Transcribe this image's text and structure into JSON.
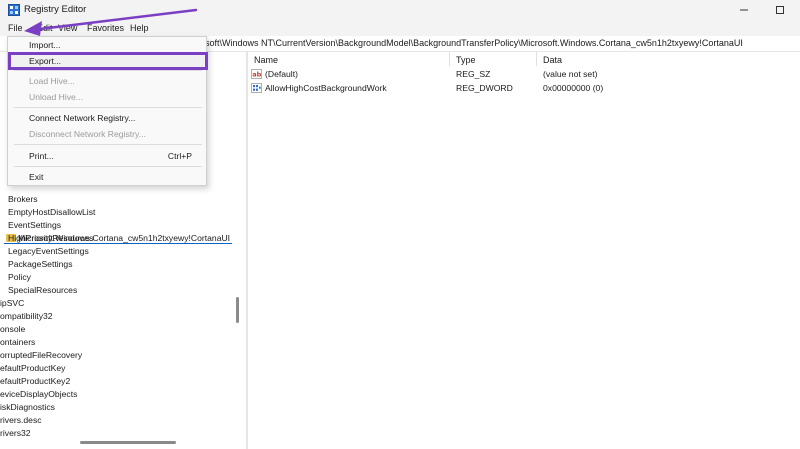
{
  "window": {
    "title": "Registry Editor"
  },
  "menubar": {
    "file": "File",
    "edit": "Edit",
    "view": "View",
    "favorites": "Favorites",
    "help": "Help"
  },
  "address": {
    "path": "osoft\\Windows NT\\CurrentVersion\\BackgroundModel\\BackgroundTransferPolicy\\Microsoft.Windows.Cortana_cw5n1h2txyewy!CortanaUI"
  },
  "file_menu": {
    "import": "Import...",
    "export": "Export...",
    "load_hive": "Load Hive...",
    "unload_hive": "Unload Hive...",
    "connect": "Connect Network Registry...",
    "disconnect": "Disconnect Network Registry...",
    "print": "Print...",
    "print_shortcut": "Ctrl+P",
    "exit": "Exit"
  },
  "tree": {
    "selected": "Microsoft.Windows.Cortana_cw5n1h2txyewy!CortanaUI",
    "children": [
      "Brokers",
      "EmptyHostDisallowList",
      "EventSettings",
      "HighPriorityResources",
      "LegacyEventSettings",
      "PackageSettings",
      "Policy",
      "SpecialResources"
    ],
    "siblings": [
      "ipSVC",
      "ompatibility32",
      "onsole",
      "ontainers",
      "orruptedFileRecovery",
      "efaultProductKey",
      "efaultProductKey2",
      "eviceDisplayObjects",
      "iskDiagnostics",
      "rivers.desc",
      "rivers32"
    ]
  },
  "list": {
    "headers": {
      "name": "Name",
      "type": "Type",
      "data": "Data"
    },
    "rows": [
      {
        "icon": "string-value-icon",
        "name": "(Default)",
        "type": "REG_SZ",
        "data": "(value not set)"
      },
      {
        "icon": "binary-value-icon",
        "name": "AllowHighCostBackgroundWork",
        "type": "REG_DWORD",
        "data": "0x00000000 (0)"
      }
    ]
  },
  "colors": {
    "highlight": "#7b3fc4",
    "menu_bg": "#f9f9f9",
    "chrome_bg": "#f3f3f3",
    "folder": "#e7c04a"
  }
}
